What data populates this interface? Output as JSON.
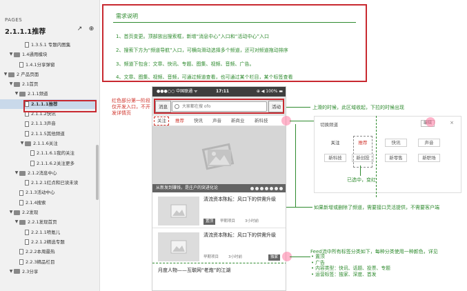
{
  "sidebar": {
    "pages_label": "PAGES",
    "current_page": "2.1.1.1推荐",
    "tree": [
      {
        "label": "1.3.5.1 专题内图集",
        "level": 4,
        "type": "doc",
        "arrow": ""
      },
      {
        "label": "1.4通用模块",
        "level": 2,
        "type": "folder",
        "arrow": "▼"
      },
      {
        "label": "1.4.1分享弹窗",
        "level": 3,
        "type": "doc",
        "arrow": ""
      },
      {
        "label": "2 产品页面",
        "level": 1,
        "type": "folder",
        "arrow": "▼"
      },
      {
        "label": "2.1首页",
        "level": 2,
        "type": "folder",
        "arrow": "▼"
      },
      {
        "label": "2.1.1频道",
        "level": 3,
        "type": "folder",
        "arrow": "▼"
      },
      {
        "label": "2.1.1.1推荐",
        "level": 4,
        "type": "doc",
        "arrow": "",
        "selected": true
      },
      {
        "label": "2.1.1.2快讯",
        "level": 4,
        "type": "doc",
        "arrow": ""
      },
      {
        "label": "2.1.1.3声音",
        "level": 4,
        "type": "doc",
        "arrow": ""
      },
      {
        "label": "2.1.1.5其他频道",
        "level": 4,
        "type": "doc",
        "arrow": ""
      },
      {
        "label": "2.1.1.6关注",
        "level": 4,
        "type": "folder",
        "arrow": "▼"
      },
      {
        "label": "2.1.1.6.1我的关注",
        "level": 5,
        "type": "doc",
        "arrow": ""
      },
      {
        "label": "2.1.1.6.2关注更多",
        "level": 5,
        "type": "doc",
        "arrow": ""
      },
      {
        "label": "2.1.2消息中心",
        "level": 3,
        "type": "folder",
        "arrow": "▼"
      },
      {
        "label": "2.1.2.1红点和已读未读",
        "level": 4,
        "type": "doc",
        "arrow": ""
      },
      {
        "label": "2.1.3活动中心",
        "level": 3,
        "type": "doc",
        "arrow": ""
      },
      {
        "label": "2.1.4搜索",
        "level": 3,
        "type": "doc",
        "arrow": ""
      },
      {
        "label": "2.2发现",
        "level": 2,
        "type": "folder",
        "arrow": "▼"
      },
      {
        "label": "2.2.1发现首页",
        "level": 3,
        "type": "folder",
        "arrow": "▼"
      },
      {
        "label": "2.2.1.1喷氪儿",
        "level": 4,
        "type": "doc",
        "arrow": ""
      },
      {
        "label": "2.2.1.2精选专题",
        "level": 4,
        "type": "doc",
        "arrow": ""
      },
      {
        "label": "2.2.2本周最热",
        "level": 3,
        "type": "doc",
        "arrow": ""
      },
      {
        "label": "2.2.3精品栏目",
        "level": 3,
        "type": "doc",
        "arrow": ""
      },
      {
        "label": "2.3分享",
        "level": 2,
        "type": "folder",
        "arrow": "▼"
      }
    ]
  },
  "requirements": {
    "title": "需求说明",
    "lines": [
      "1、首页变更。顶部放出搜索框，新增“消息中心”入口和“活动中心”入口",
      "2、搜索下方为“频道导航”入口，可横向滑动选择多个频道，还可对频道拖动排序",
      "3、频道下包含：文章、快讯、专题、图集、视频、音频、广告。",
      "4、文章、图集、视频、音频，可通过频道查看，也可通过某个栏目，某个标签查看"
    ]
  },
  "side_note": "红色部分第一阶段仅开发入口，不开发详情页",
  "phone": {
    "status": {
      "carrier": "●●●○○ 中国联通 ᯤ",
      "time": "17:11",
      "right": "⊕ ◀ 100% ▬"
    },
    "msg_button": "消息",
    "activity_button": "活动",
    "search_placeholder": "大家都在搜 ofo",
    "tabs": [
      "关注",
      "推荐",
      "快讯",
      "声音",
      "新商业",
      "新科技"
    ],
    "banner_caption": "从新发到赚钱，是庄户的突进化论",
    "feeds": [
      {
        "title": "清流资本陈耘：风口下的供需升级",
        "badge": "置顶",
        "source": "早期项目",
        "time": "3小时前"
      },
      {
        "title": "清流资本陈耘：风口下的供需升级",
        "badge": "",
        "source": "早期项目",
        "time": "3小时前"
      },
      {
        "title": "清流资本陈耘：风口下的供需升级",
        "badge": "独家",
        "source": "早期项目",
        "time": "3小时前"
      }
    ],
    "last_feed_title": "月度人物——互联网“老炮”的江湖"
  },
  "channel_panel": {
    "title": "切换频道",
    "edit_label": "编辑",
    "close": "×",
    "chips": [
      "关注",
      "推荐",
      "快讯",
      "声音",
      "新科技",
      "新创投",
      "新零售",
      "新职场"
    ],
    "active_chip": "推荐"
  },
  "annotations": {
    "scroll_note": "上滑的时候，此区域收起，下拉的时候出现",
    "selected_note": "已选中，变红",
    "channel_note": "如果新增或删除了频道，需要接口灵活提供，不需要客户端",
    "feed_note": "Feed流中所有标签分类如下，每种分类使用一种颜色，详见",
    "feed_list": [
      "• 置顶",
      "• 广告",
      "• 内容类型：快讯、话题、投票、专题",
      "• 运营标签：独家、深度、首发"
    ]
  },
  "colors": {
    "accent_red": "#c8282f",
    "annotation_green": "#2d8a2d",
    "selected_bg": "#c9d9ea"
  }
}
